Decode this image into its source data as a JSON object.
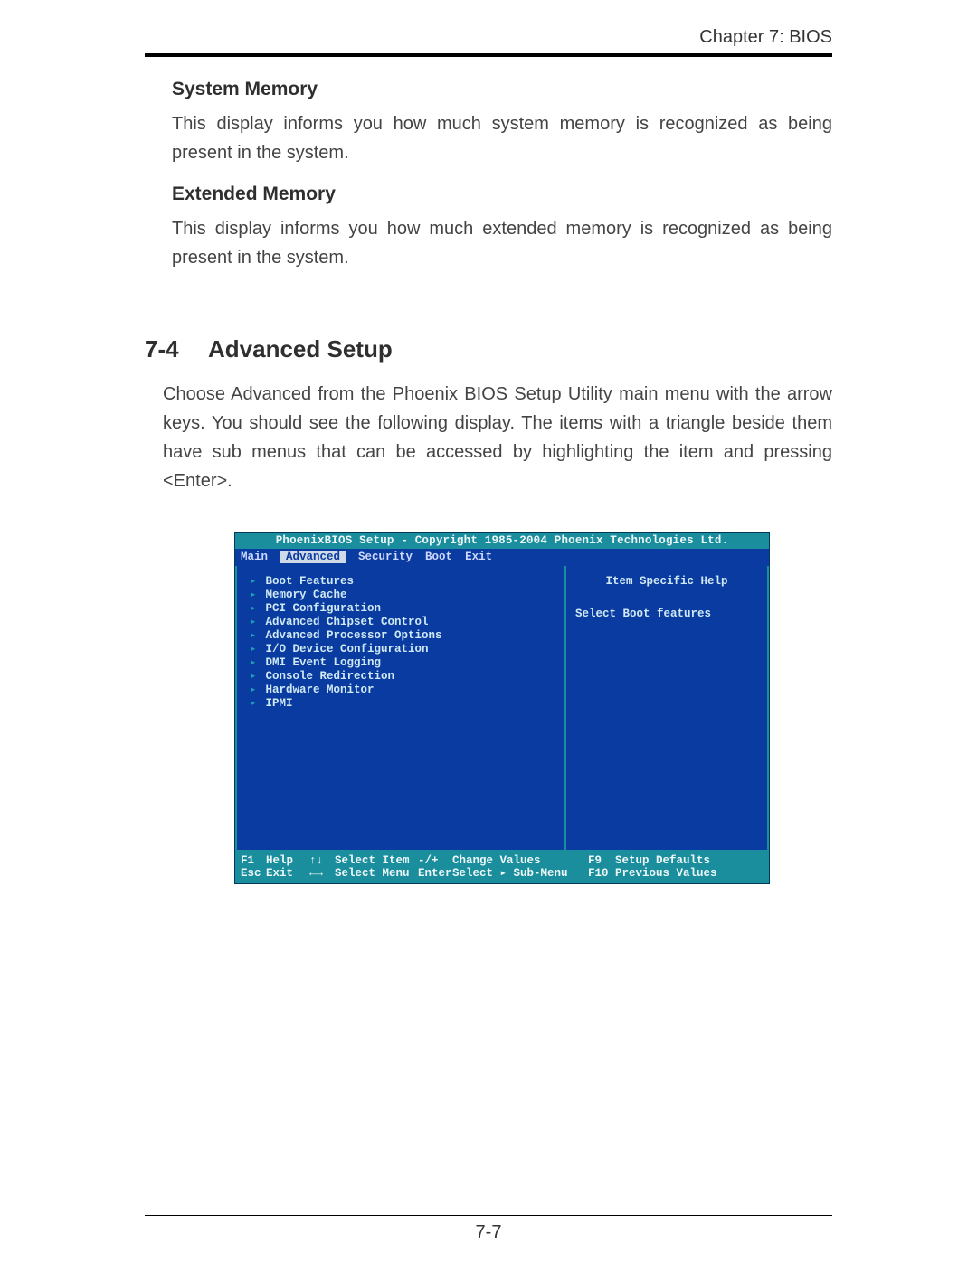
{
  "header": {
    "chapter": "Chapter 7: BIOS"
  },
  "section_sysmem": {
    "title": "System Memory",
    "text": "This display informs you how much system memory is recognized as being present in the system."
  },
  "section_extmem": {
    "title": "Extended Memory",
    "text": "This display informs you how much extended memory is recognized as being present in the system."
  },
  "section_advanced_setup": {
    "number": "7-4",
    "title": "Advanced Setup",
    "text": "Choose Advanced from the  Phoenix BIOS Setup Utility main menu with the arrow keys. You should see the following display.  The items with a triangle beside them have sub menus that can be accessed by highlighting the item and pressing <Enter>."
  },
  "bios": {
    "title": "PhoenixBIOS Setup - Copyright 1985-2004 Phoenix Technologies Ltd.",
    "tabs": [
      "Main",
      "Advanced",
      "Security",
      "Boot",
      "Exit"
    ],
    "tabs_active_index": 1,
    "menu": [
      "Boot Features",
      "Memory Cache",
      "PCI Configuration",
      "Advanced Chipset Control",
      "Advanced Processor Options",
      "I/O Device Configuration",
      "DMI Event Logging",
      "Console Redirection",
      "Hardware Monitor",
      "IPMI"
    ],
    "help_title": "Item Specific Help",
    "help_text": "Select Boot features",
    "footer": {
      "r1c1k": "F1",
      "r1c1v": "Help",
      "r1c2k": "↑↓",
      "r1c2v": "Select Item",
      "r1c3k": "-/+",
      "r1c3v": "Change Values",
      "r1c4k": "F9",
      "r1c4v": "Setup Defaults",
      "r2c1k": "Esc",
      "r2c1v": "Exit",
      "r2c2k": "←→",
      "r2c2v": "Select Menu",
      "r2c3k": "Enter",
      "r2c3v": "Select ▸ Sub-Menu",
      "r2c4k": "F10",
      "r2c4v": "Previous Values"
    }
  },
  "page_number": "7-7"
}
